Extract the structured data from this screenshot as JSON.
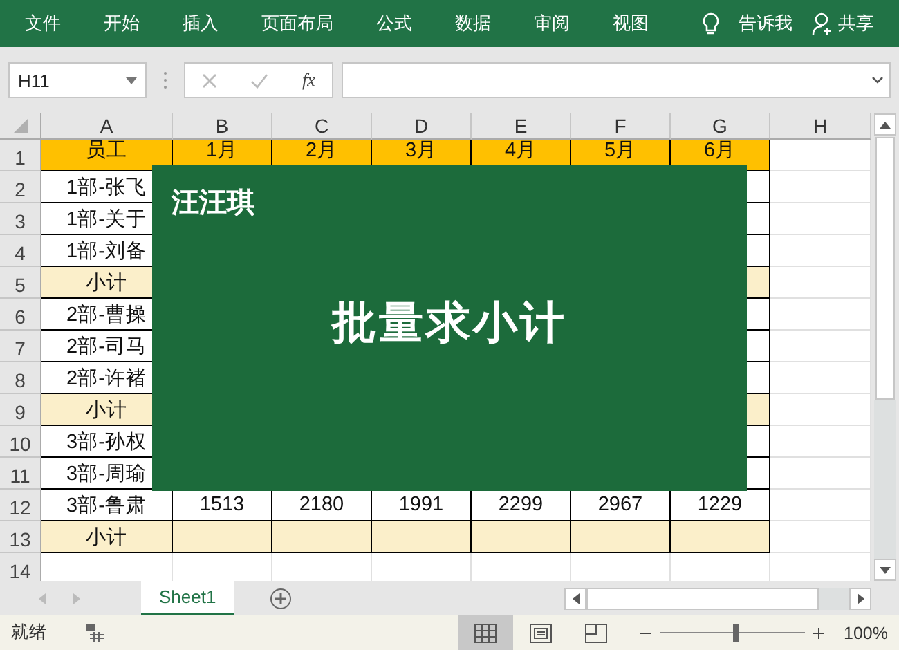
{
  "ribbon": {
    "tabs": [
      "文件",
      "开始",
      "插入",
      "页面布局",
      "公式",
      "数据",
      "审阅",
      "视图"
    ],
    "tell_me": "告诉我",
    "share": "共享"
  },
  "formula_bar": {
    "name_box": "H11",
    "fx": "fx"
  },
  "columns": [
    "A",
    "B",
    "C",
    "D",
    "E",
    "F",
    "G",
    "H"
  ],
  "rows": [
    {
      "number": "1",
      "kind": "header",
      "cells": [
        "员工",
        "1月",
        "2月",
        "3月",
        "4月",
        "5月",
        "6月"
      ]
    },
    {
      "number": "2",
      "kind": "member",
      "cells": [
        "1部-张飞"
      ]
    },
    {
      "number": "3",
      "kind": "member",
      "cells": [
        "1部-关于"
      ]
    },
    {
      "number": "4",
      "kind": "member",
      "cells": [
        "1部-刘备"
      ]
    },
    {
      "number": "5",
      "kind": "subtotal",
      "cells": [
        "小计"
      ]
    },
    {
      "number": "6",
      "kind": "member",
      "cells": [
        "2部-曹操"
      ]
    },
    {
      "number": "7",
      "kind": "member",
      "cells": [
        "2部-司马"
      ]
    },
    {
      "number": "8",
      "kind": "member",
      "cells": [
        "2部-许褚"
      ]
    },
    {
      "number": "9",
      "kind": "subtotal",
      "cells": [
        "小计"
      ]
    },
    {
      "number": "10",
      "kind": "member",
      "cells": [
        "3部-孙权"
      ]
    },
    {
      "number": "11",
      "kind": "member",
      "cells": [
        "3部-周瑜"
      ]
    },
    {
      "number": "12",
      "kind": "member",
      "cells": [
        "3部-鲁肃",
        "1513",
        "2180",
        "1991",
        "2299",
        "2967",
        "1229"
      ]
    },
    {
      "number": "13",
      "kind": "subtotal",
      "cells": [
        "小计"
      ]
    },
    {
      "number": "14",
      "kind": "blank",
      "cells": []
    }
  ],
  "banner": {
    "author": "汪汪琪",
    "title": "批量求小计"
  },
  "sheet_tabs": [
    {
      "label": "Sheet1",
      "selected": true
    }
  ],
  "status_bar": {
    "status": "就绪",
    "views": [
      {
        "kind": "normal",
        "selected": true
      },
      {
        "kind": "page_layout",
        "selected": false
      },
      {
        "kind": "page_break",
        "selected": false
      }
    ],
    "zoom": {
      "level": 0.5
    },
    "zoom_label": "100%"
  }
}
